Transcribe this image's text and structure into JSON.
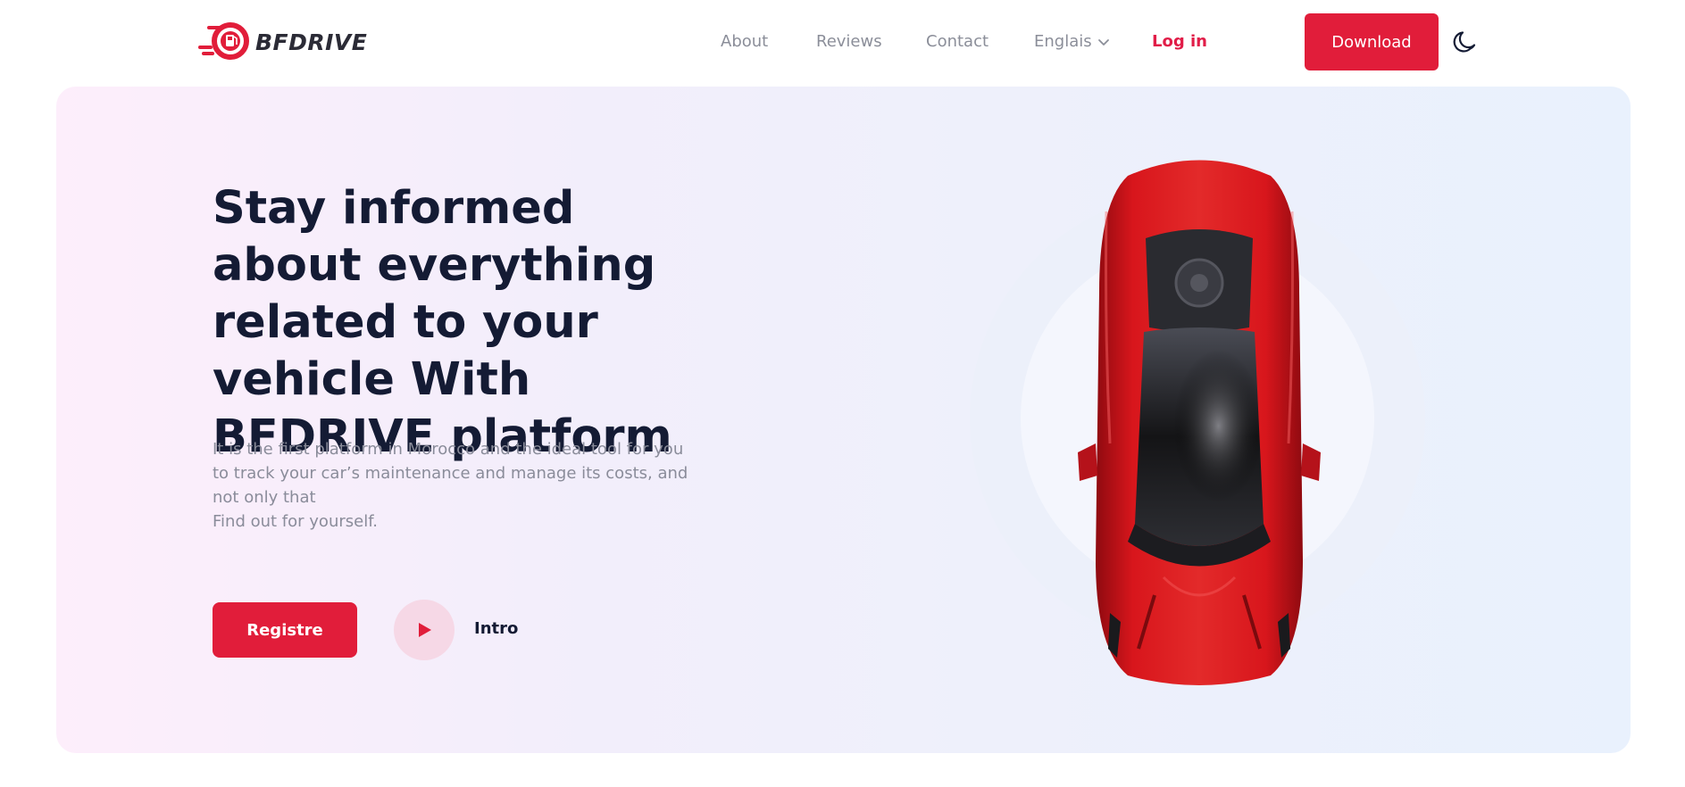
{
  "brand": {
    "name": "BFDRIVE",
    "accent_color": "#e11d3a",
    "logo_icon": "gas-pump-drop-icon"
  },
  "nav": {
    "about": "About",
    "reviews": "Reviews",
    "contact": "Contact",
    "language": "Englais",
    "login": "Log in"
  },
  "header": {
    "download_label": "Download",
    "theme_icon": "moon-icon"
  },
  "hero": {
    "headline_regular": "Stay informed about everything related to your vehicle",
    "headline_strong": "With BFDRIVE platform",
    "description_line1": "It is the first platform in Morocco and the ideal tool for you to track your car’s maintenance and manage its costs, and not only that",
    "description_line2": "Find out for yourself.",
    "register_label": "Registre",
    "intro_label": "Intro",
    "play_icon": "play-icon",
    "image": "red-sports-car-top-view"
  }
}
